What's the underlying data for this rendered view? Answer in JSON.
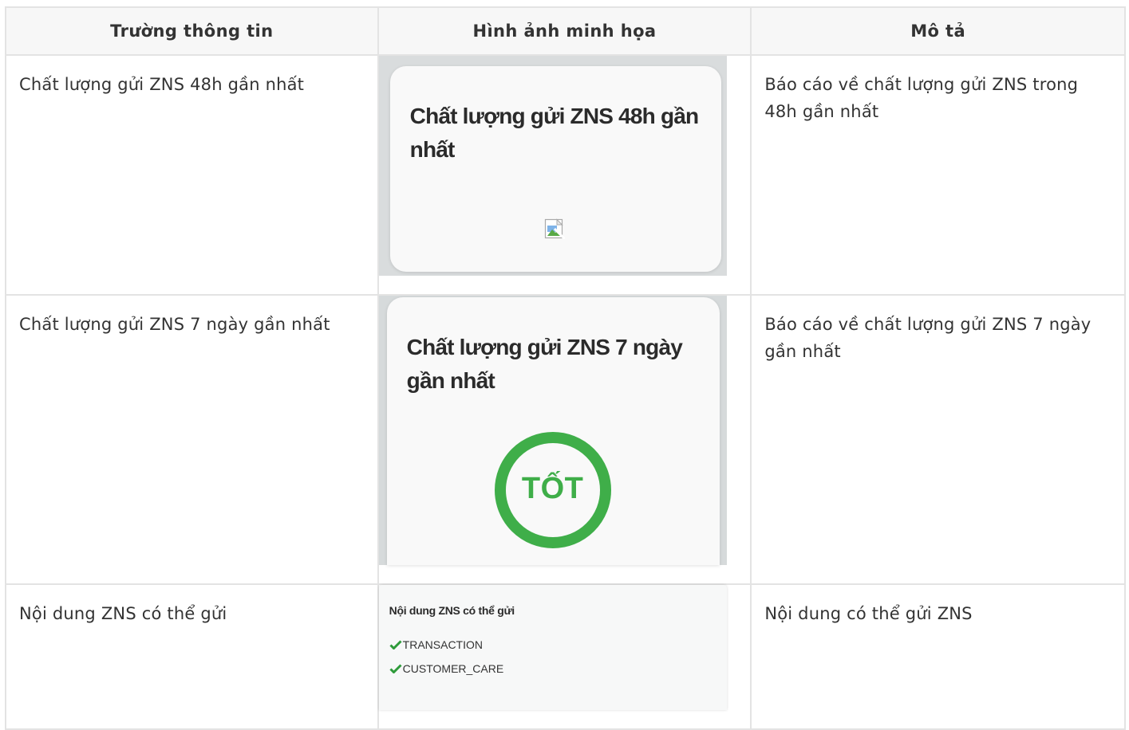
{
  "table": {
    "headers": [
      "Trường thông tin",
      "Hình ảnh minh họa",
      "Mô tả"
    ],
    "rows": [
      {
        "field": "Chất lượng gửi ZNS 48h gần nhất",
        "illustration_title": "Chất lượng gửi ZNS 48h gần nhất",
        "description": "Báo cáo về chất lượng gửi ZNS trong 48h gần nhất"
      },
      {
        "field": "Chất lượng gửi ZNS 7 ngày gần nhất",
        "illustration_title": "Chất lượng gửi ZNS 7 ngày gần nhất",
        "status_label": "TỐT",
        "description": "Báo cáo về chất lượng gửi ZNS 7 ngày gần nhất"
      },
      {
        "field": "Nội dung ZNS có thể gửi",
        "illustration_title": "Nội dung ZNS có thể gửi",
        "items": [
          "TRANSACTION",
          "CUSTOMER_CARE"
        ],
        "description": "Nội dung có thể gửi ZNS"
      }
    ]
  },
  "colors": {
    "status_green": "#3fae49",
    "check_green": "#2e9b3a",
    "header_bg": "#f7f7f7",
    "border": "#e3e3e3"
  },
  "icons": {
    "broken_image": "broken-image-icon",
    "check": "check-icon",
    "status_ring": "status-ring-icon"
  }
}
